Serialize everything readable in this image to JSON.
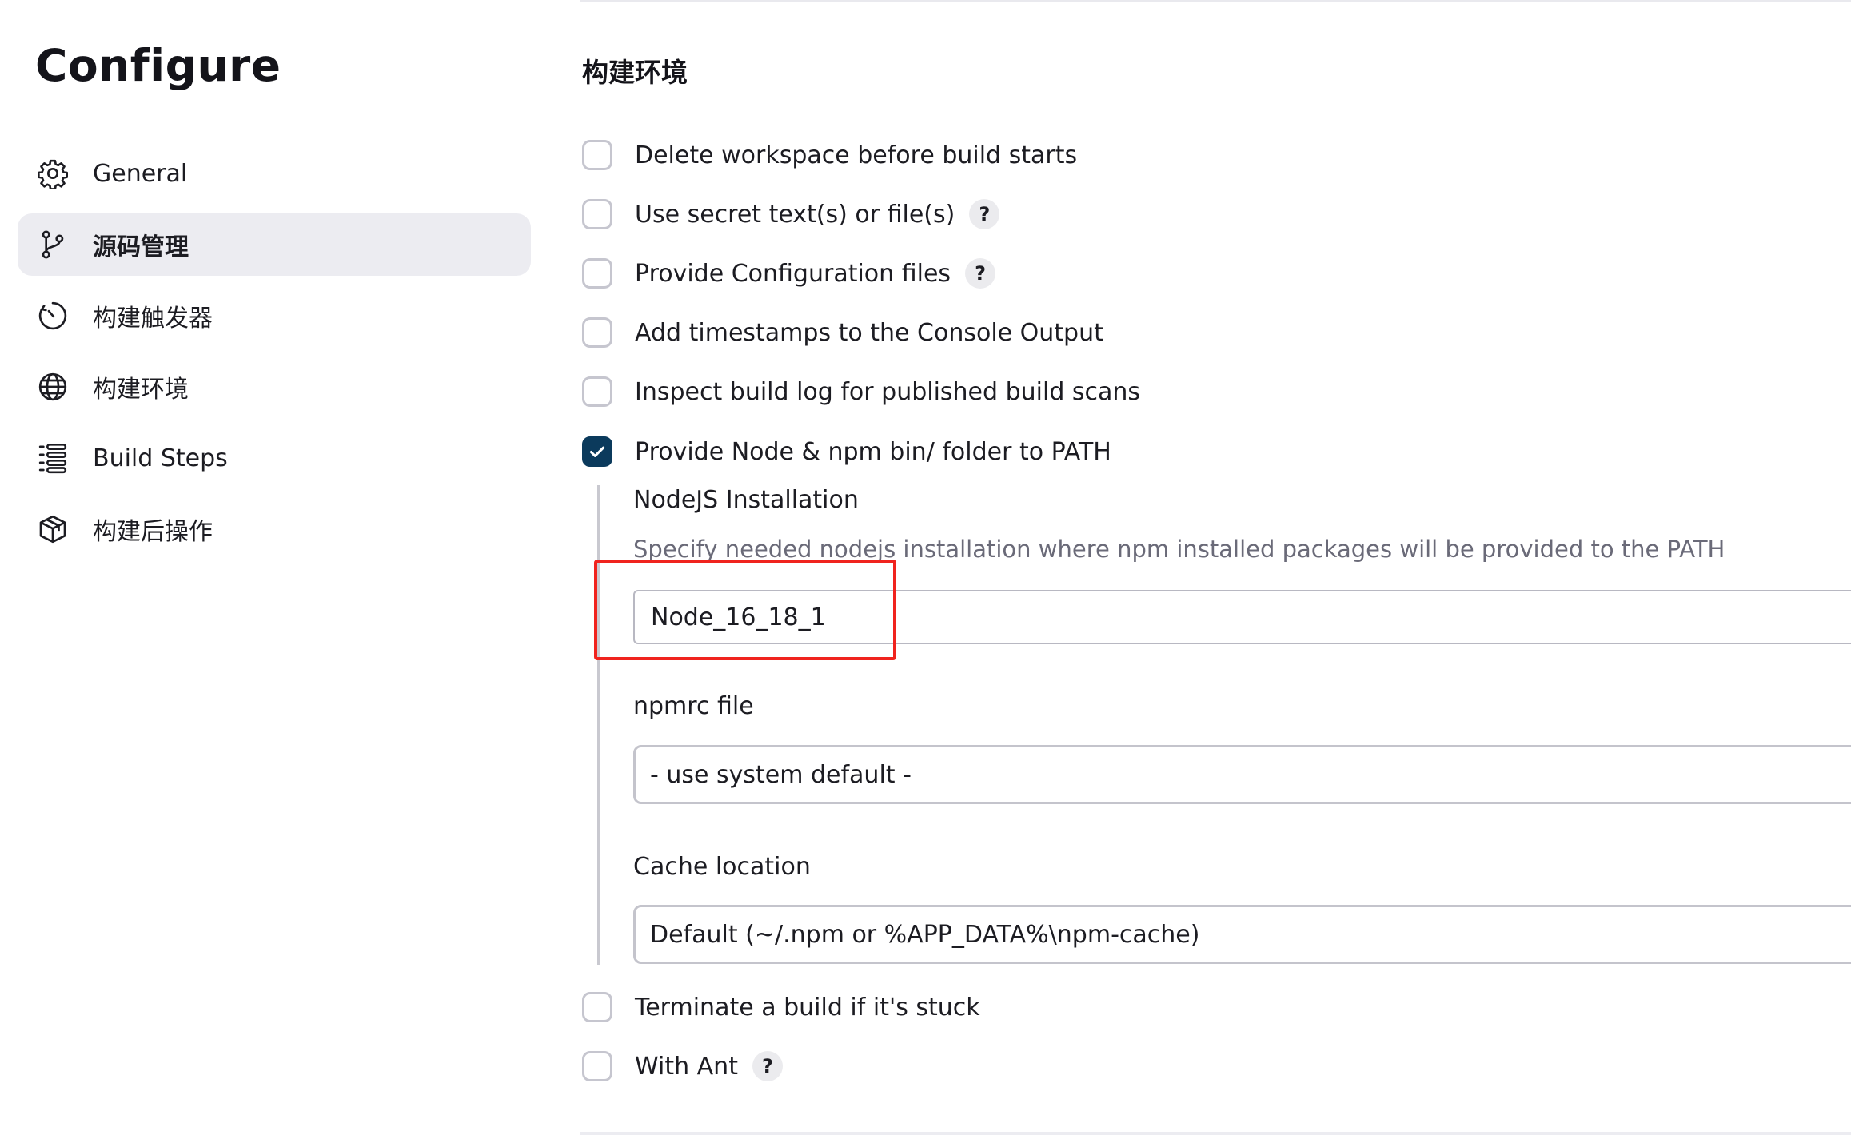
{
  "sidebar": {
    "title": "Configure",
    "items": [
      {
        "label": "General",
        "icon": "gear-icon",
        "active": false
      },
      {
        "label": "源码管理",
        "icon": "branch-icon",
        "active": true
      },
      {
        "label": "构建触发器",
        "icon": "clock-icon",
        "active": false
      },
      {
        "label": "构建环境",
        "icon": "globe-icon",
        "active": false
      },
      {
        "label": "Build Steps",
        "icon": "list-icon",
        "active": false
      },
      {
        "label": "构建后操作",
        "icon": "package-icon",
        "active": false
      }
    ]
  },
  "main": {
    "section_title": "构建环境",
    "options": [
      {
        "label": "Delete workspace before build starts",
        "checked": false,
        "help": false
      },
      {
        "label": "Use secret text(s) or file(s)",
        "checked": false,
        "help": true
      },
      {
        "label": "Provide Configuration files",
        "checked": false,
        "help": true
      },
      {
        "label": "Add timestamps to the Console Output",
        "checked": false,
        "help": false
      },
      {
        "label": "Inspect build log for published build scans",
        "checked": false,
        "help": false
      },
      {
        "label": "Provide Node & npm bin/ folder to PATH",
        "checked": true,
        "help": false
      },
      {
        "label": "Terminate a build if it's stuck",
        "checked": false,
        "help": false
      },
      {
        "label": "With Ant",
        "checked": false,
        "help": true
      }
    ],
    "help_glyph": "?",
    "nodejs": {
      "label": "NodeJS Installation",
      "description": "Specify needed nodejs installation where npm installed packages will be provided to the PATH",
      "value": "Node_16_18_1",
      "npmrc_label": "npmrc file",
      "npmrc_value": "- use system default -",
      "cache_label": "Cache location",
      "cache_value": "Default (~/.npm or %APP_DATA%\\npm-cache)"
    }
  },
  "colors": {
    "accent": "#0b3a5c",
    "active_bg": "#ececf1",
    "highlight": "#f0231e"
  }
}
